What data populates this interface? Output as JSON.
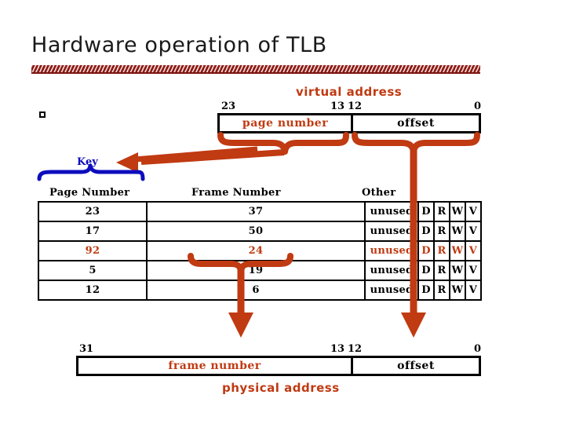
{
  "slide": {
    "title": "Hardware operation of TLB",
    "bullet_marker": "empty-square-bullet"
  },
  "virtual_address": {
    "label": "virtual address",
    "bits": {
      "high": "23",
      "mid_left": "13",
      "mid_right": "12",
      "low": "0"
    },
    "fields": [
      {
        "name": "page number",
        "color": "#c03a12"
      },
      {
        "name": "offset",
        "color": "#000000"
      }
    ]
  },
  "key": {
    "label": "Key",
    "color": "#0d0dbe"
  },
  "tlb": {
    "headers": [
      "Page Number",
      "Frame Number",
      "Other"
    ],
    "flag_labels": [
      "D",
      "R",
      "W",
      "V"
    ],
    "unused_label": "unused",
    "rows": [
      {
        "page": "23",
        "frame": "37",
        "other": "unused",
        "flags": [
          "D",
          "R",
          "W",
          "V"
        ],
        "highlight": false
      },
      {
        "page": "17",
        "frame": "50",
        "other": "unused",
        "flags": [
          "D",
          "R",
          "W",
          "V"
        ],
        "highlight": false
      },
      {
        "page": "92",
        "frame": "24",
        "other": "unused",
        "flags": [
          "D",
          "R",
          "W",
          "V"
        ],
        "highlight": true
      },
      {
        "page": "5",
        "frame": "19",
        "other": "unused",
        "flags": [
          "D",
          "R",
          "W",
          "V"
        ],
        "highlight": false
      },
      {
        "page": "12",
        "frame": "6",
        "other": "unused",
        "flags": [
          "D",
          "R",
          "W",
          "V"
        ],
        "highlight": false
      }
    ]
  },
  "physical_address": {
    "label": "physical address",
    "bits": {
      "high": "31",
      "mid_left": "13",
      "mid_right": "12",
      "low": "0"
    },
    "fields": [
      {
        "name": "frame number",
        "color": "#c03a12"
      },
      {
        "name": "offset",
        "color": "#000000"
      }
    ]
  },
  "colors": {
    "accent_orange": "#c03a12",
    "accent_blue": "#0d0dbe",
    "rule_dark_red": "#8e1b14",
    "text_black": "#000000",
    "background": "#ffffff"
  }
}
